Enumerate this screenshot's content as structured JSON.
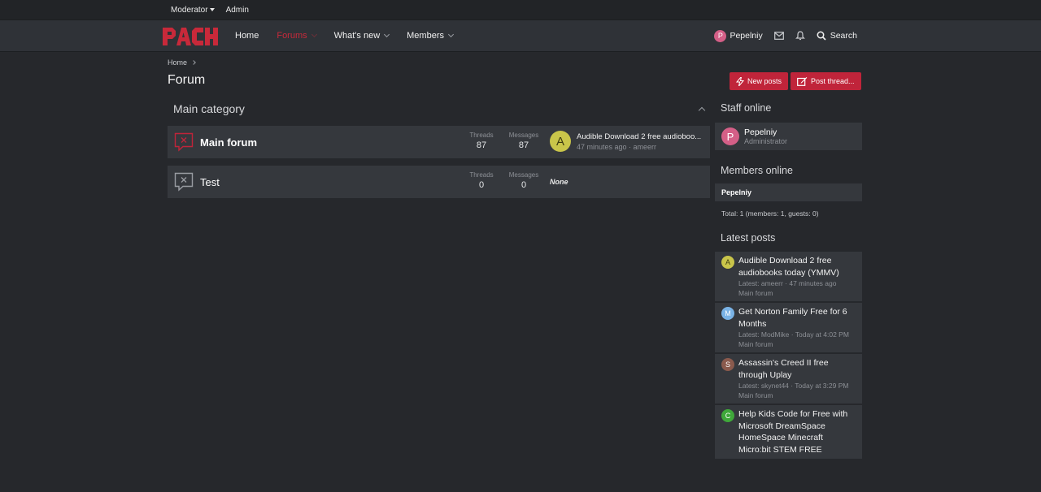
{
  "staff_bar": {
    "moderator": "Moderator",
    "admin": "Admin"
  },
  "nav": {
    "logo_text": "PACK",
    "tabs": [
      {
        "label": "Home",
        "active": false
      },
      {
        "label": "Forums",
        "active": true
      },
      {
        "label": "What's new",
        "active": false
      },
      {
        "label": "Members",
        "active": false
      }
    ],
    "user": {
      "name": "Pepelniy",
      "initial": "P"
    },
    "search_label": "Search"
  },
  "breadcrumb": {
    "home": "Home"
  },
  "page_title": "Forum",
  "buttons": {
    "new_posts": "New posts",
    "post_thread": "Post thread..."
  },
  "category": {
    "title": "Main category",
    "forums": [
      {
        "title": "Main forum",
        "unread": true,
        "threads_label": "Threads",
        "threads": "87",
        "messages_label": "Messages",
        "messages": "87",
        "last_post": {
          "initial": "A",
          "title": "Audible Download 2 free audioboo...",
          "meta": "47 minutes ago · ameerr"
        }
      },
      {
        "title": "Test",
        "unread": false,
        "threads_label": "Threads",
        "threads": "0",
        "messages_label": "Messages",
        "messages": "0",
        "none_text": "None"
      }
    ]
  },
  "sidebar": {
    "staff_online": {
      "title": "Staff online",
      "user": {
        "initial": "P",
        "name": "Pepelniy",
        "role": "Administrator"
      }
    },
    "members_online": {
      "title": "Members online",
      "member": "Pepelniy",
      "total": "Total: 1 (members: 1, guests: 0)"
    },
    "latest_posts": {
      "title": "Latest posts",
      "items": [
        {
          "initial": "A",
          "title": "Audible Download 2 free audiobooks today (YMMV)",
          "meta": "Latest: ameerr · 47 minutes ago",
          "forum": "Main forum"
        },
        {
          "initial": "M",
          "title": "Get Norton Family Free for 6 Months",
          "meta": "Latest: ModMike · Today at 4:02 PM",
          "forum": "Main forum"
        },
        {
          "initial": "S",
          "title": "Assassin's Creed II free through Uplay",
          "meta": "Latest: skynet44 · Today at 3:29 PM",
          "forum": "Main forum"
        },
        {
          "initial": "C",
          "title": "Help Kids Code for Free with Microsoft DreamSpace HomeSpace Minecraft Micro:bit STEM FREE",
          "meta": "",
          "forum": ""
        }
      ]
    }
  },
  "colors": {
    "accent": "#c0243a",
    "background": "#26282c",
    "row": "#35383d"
  }
}
